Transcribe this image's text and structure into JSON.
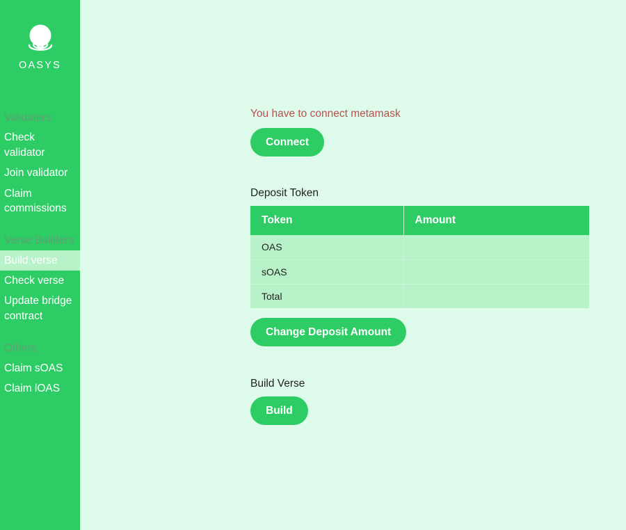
{
  "brand": {
    "name": "OASYS",
    "logo_icon": "oasys-logo-icon"
  },
  "sidebar": {
    "sections": [
      {
        "header": "Validators",
        "items": [
          {
            "label": "Check validator",
            "active": false
          },
          {
            "label": "Join validator",
            "active": false
          },
          {
            "label": "Claim commissions",
            "active": false
          }
        ]
      },
      {
        "header": "Verse Builders",
        "items": [
          {
            "label": "Build verse",
            "active": true
          },
          {
            "label": "Check verse",
            "active": false
          },
          {
            "label": "Update bridge contract",
            "active": false
          }
        ]
      },
      {
        "header": "Others",
        "items": [
          {
            "label": "Claim sOAS",
            "active": false
          },
          {
            "label": "Claim lOAS",
            "active": false
          }
        ]
      }
    ]
  },
  "main": {
    "wallet_warning": "You have to connect metamask",
    "connect_button": "Connect",
    "deposit": {
      "title": "Deposit Token",
      "columns": [
        "Token",
        "Amount"
      ],
      "rows": [
        {
          "token": "OAS",
          "amount": ""
        },
        {
          "token": "sOAS",
          "amount": ""
        },
        {
          "token": "Total",
          "amount": ""
        }
      ],
      "change_button": "Change Deposit Amount"
    },
    "build": {
      "title": "Build Verse",
      "button": "Build"
    }
  },
  "colors": {
    "brand_green": "#2ecc65",
    "page_bg": "#defaea",
    "table_body": "#b8f2c8",
    "warning_red": "#b5524e",
    "section_header": "#5fa074"
  }
}
